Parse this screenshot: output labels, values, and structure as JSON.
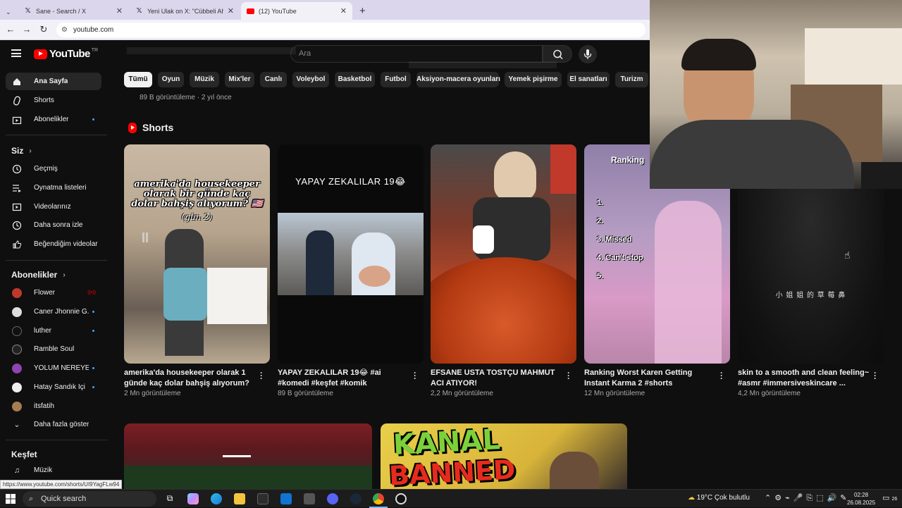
{
  "browser": {
    "tabs": [
      {
        "title": "Sane - Search / X",
        "icon": "x-logo-icon",
        "active": false
      },
      {
        "title": "Yeni Ulak on X: \"Cübbeli Ahmet",
        "icon": "x-logo-icon",
        "active": false
      },
      {
        "title": "(12) YouTube",
        "icon": "youtube-icon",
        "active": true
      }
    ],
    "url": "youtube.com",
    "status_url": "https://www.youtube.com/shorts/UI9YagFLw94"
  },
  "header": {
    "logo_text": "YouTube",
    "country_code": "TR",
    "search_placeholder": "Ara"
  },
  "chips": [
    "Tümü",
    "Oyun",
    "Müzik",
    "Mix'ler",
    "Canlı",
    "Voleybol",
    "Basketbol",
    "Futbol",
    "Aksiyon-macera oyunları",
    "Yemek pişirme",
    "El sanatları",
    "Turizm"
  ],
  "sidebar": {
    "main": [
      {
        "label": "Ana Sayfa",
        "icon": "home-icon"
      },
      {
        "label": "Shorts",
        "icon": "shorts-icon"
      },
      {
        "label": "Abonelikler",
        "icon": "subscriptions-icon"
      }
    ],
    "you_title": "Siz",
    "you": [
      {
        "label": "Geçmiş",
        "icon": "history-icon"
      },
      {
        "label": "Oynatma listeleri",
        "icon": "playlists-icon"
      },
      {
        "label": "Videolarınız",
        "icon": "your-videos-icon"
      },
      {
        "label": "Daha sonra izle",
        "icon": "watch-later-icon"
      },
      {
        "label": "Beğendiğim videolar",
        "icon": "liked-icon"
      }
    ],
    "subs_title": "Abonelikler",
    "subs": [
      {
        "label": "Flower",
        "status": "live"
      },
      {
        "label": "Caner Jhonnie G...",
        "status": "new"
      },
      {
        "label": "luther",
        "status": "new"
      },
      {
        "label": "Ramble Soul",
        "status": "none"
      },
      {
        "label": "YOLUM NEREYE ...",
        "status": "new"
      },
      {
        "label": "Hatay Sandık İçi",
        "status": "new"
      },
      {
        "label": "itsfatih",
        "status": "none"
      }
    ],
    "show_more": "Daha fazla göster",
    "explore_title": "Keşfet",
    "explore": [
      {
        "label": "Müzik",
        "icon": "music-icon"
      }
    ]
  },
  "main": {
    "prev_meta": "89 B görüntüleme · 2 yıl önce",
    "shorts_title": "Shorts",
    "shorts": [
      {
        "title": "amerika'da housekeeper olarak 1 günde kaç dolar bahşiş alıyorum? us ...",
        "views": "2 Mn görüntüleme",
        "overlay": "amerika'da housekeeper olarak bir günde kaç dolar bahşiş alıyorum? 🇺🇸",
        "overlay2": "(gün 2)"
      },
      {
        "title": "YAPAY ZEKALILAR 19😂 #ai #komedi #keşfet #komik #yapayzeka #funny ...",
        "views": "89 B görüntüleme",
        "overlay": "YAPAY ZEKALILAR 19😂"
      },
      {
        "title": "EFSANE USTA TOSTÇU MAHMUT ACI ATIYOR!",
        "views": "2,2 Mn görüntüleme"
      },
      {
        "title": "Ranking Worst Karen Getting Instant Karma 2 #shorts",
        "views": "12 Mn görüntüleme",
        "overlay": "Ranking",
        "list": [
          "1.",
          "2.",
          "3. Missed",
          "4. Can't stop",
          "5."
        ]
      },
      {
        "title": "skin to a smooth and clean feeling~ #asmr #immersiveskincare ...",
        "views": "4,2 Mn görüntüleme",
        "overlay": "小 姐 姐 的 草 莓 鼻"
      }
    ],
    "video2_overlay": [
      "KANAL",
      "BANNED"
    ]
  },
  "taskbar": {
    "search_label": "Quick search",
    "weather": "19°C  Çok bulutlu",
    "time": "02:28",
    "date": "26.08.2025",
    "notif_count": "26"
  },
  "colors": {
    "accent": "#ff0000",
    "bg": "#0f0f0f",
    "chip": "#272727",
    "link_dot": "#3ea6ff"
  }
}
